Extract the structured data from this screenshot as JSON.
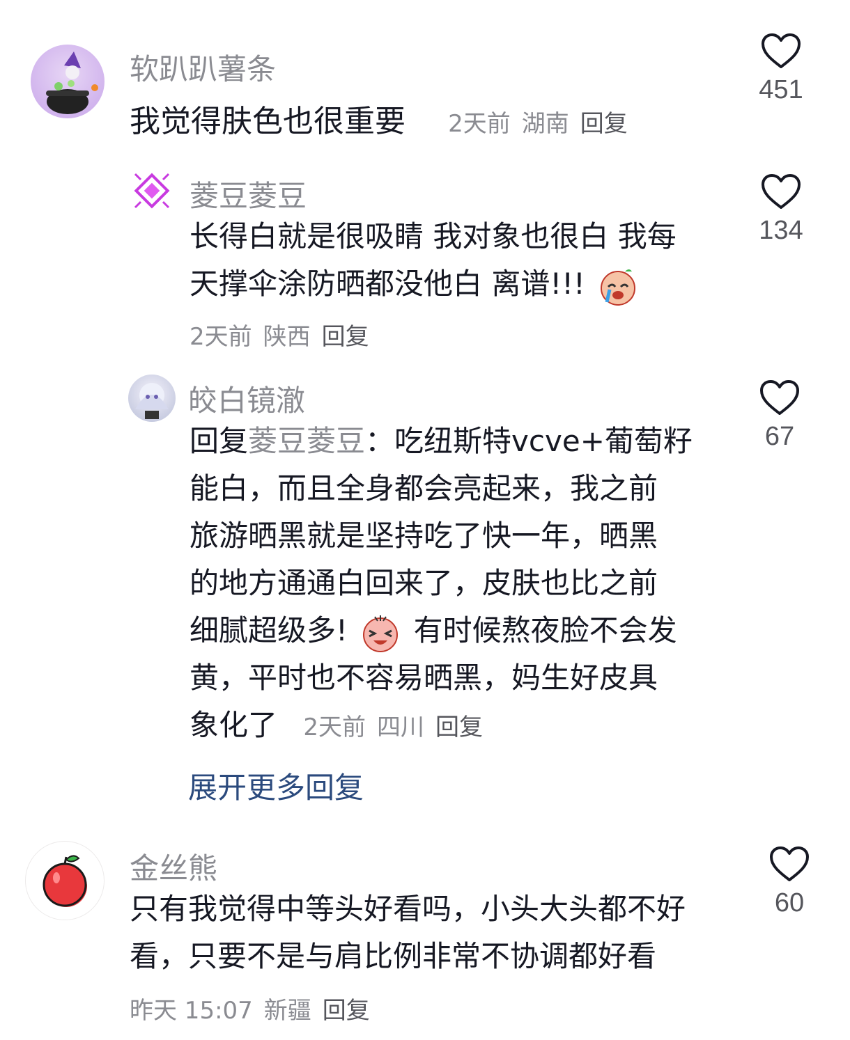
{
  "comments": [
    {
      "username": "软趴趴薯条",
      "text": "我觉得肤色也很重要",
      "time": "2天前",
      "location": "湖南",
      "reply_label": "回复",
      "likes": "451"
    },
    {
      "username": "菱豆菱豆",
      "text_line1": "长得白就是很吸睛 我对象也很白 我每",
      "text_line2": "天撑伞涂防晒都没他白 离谱!!!",
      "time": "2天前",
      "location": "陕西",
      "reply_label": "回复",
      "likes": "134"
    },
    {
      "username": "皎白镜澈",
      "reply_prefix": "回复",
      "mention": "菱豆菱豆",
      "colon": "：",
      "line1": "吃纽斯特vcve+葡萄籽",
      "line2": "能白，而且全身都会亮起来，我之前",
      "line3": "旅游晒黑就是坚持吃了快一年，晒黑",
      "line4": "的地方通通白回来了，皮肤也比之前",
      "line5a": "细腻超级多!",
      "line5b": "有时候熬夜脸不会发",
      "line6": "黄，平时也不容易晒黑，妈生好皮具",
      "line7": "象化了",
      "time": "2天前",
      "location": "四川",
      "reply_label": "回复",
      "likes": "67"
    },
    {
      "username": "金丝熊",
      "text_line1": "只有我觉得中等头好看吗，小头大头都不好",
      "text_line2": "看，只要不是与肩比例非常不协调都好看",
      "time": "昨天 15:07",
      "location": "新疆",
      "reply_label": "回复",
      "likes": "60"
    }
  ],
  "expand_label": "展开更多回复",
  "colors": {
    "username": "#8a8b91",
    "text": "#161823",
    "link": "#2b4a7d",
    "heart": "#161823"
  }
}
